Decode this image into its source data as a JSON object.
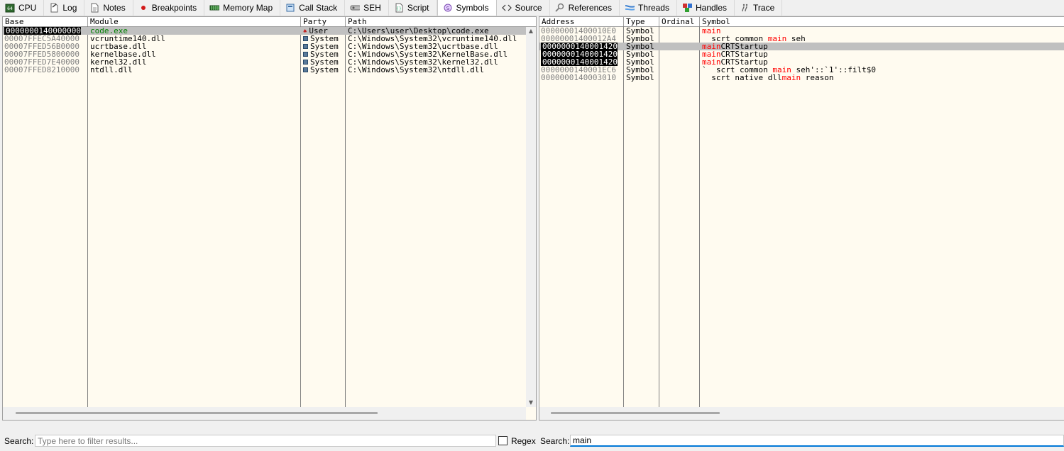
{
  "tabs": [
    {
      "label": "CPU",
      "icon": "cpu-icon"
    },
    {
      "label": "Log",
      "icon": "log-icon"
    },
    {
      "label": "Notes",
      "icon": "notes-icon"
    },
    {
      "label": "Breakpoints",
      "icon": "breakpoint-dot-icon"
    },
    {
      "label": "Memory Map",
      "icon": "memory-map-icon"
    },
    {
      "label": "Call Stack",
      "icon": "call-stack-icon"
    },
    {
      "label": "SEH",
      "icon": "seh-icon"
    },
    {
      "label": "Script",
      "icon": "script-icon"
    },
    {
      "label": "Symbols",
      "icon": "symbols-icon"
    },
    {
      "label": "Source",
      "icon": "source-icon"
    },
    {
      "label": "References",
      "icon": "references-icon"
    },
    {
      "label": "Threads",
      "icon": "threads-icon"
    },
    {
      "label": "Handles",
      "icon": "handles-icon"
    },
    {
      "label": "Trace",
      "icon": "trace-icon"
    }
  ],
  "active_tab": "Symbols",
  "modules": {
    "headers": {
      "base": "Base",
      "module": "Module",
      "party": "Party",
      "path": "Path"
    },
    "rows": [
      {
        "base": "0000000140000000",
        "module": "code.exe",
        "party": "User",
        "path": "C:\\Users\\user\\Desktop\\code.exe"
      },
      {
        "base": "00007FFEC5A40000",
        "module": "vcruntime140.dll",
        "party": "System",
        "path": "C:\\Windows\\System32\\vcruntime140.dll"
      },
      {
        "base": "00007FFED56B0000",
        "module": "ucrtbase.dll",
        "party": "System",
        "path": "C:\\Windows\\System32\\ucrtbase.dll"
      },
      {
        "base": "00007FFED5800000",
        "module": "kernelbase.dll",
        "party": "System",
        "path": "C:\\Windows\\System32\\KernelBase.dll"
      },
      {
        "base": "00007FFED7E40000",
        "module": "kernel32.dll",
        "party": "System",
        "path": "C:\\Windows\\System32\\kernel32.dll"
      },
      {
        "base": "00007FFED8210000",
        "module": "ntdll.dll",
        "party": "System",
        "path": "C:\\Windows\\System32\\ntdll.dll"
      }
    ]
  },
  "symbols": {
    "headers": {
      "address": "Address",
      "type": "Type",
      "ordinal": "Ordinal",
      "symbol": "Symbol"
    },
    "rows": [
      {
        "address": "00000001400010E0",
        "type": "Symbol",
        "ordinal": "",
        "pre": "",
        "match": "main",
        "post": ""
      },
      {
        "address": "00000001400012A4",
        "type": "Symbol",
        "ordinal": "",
        "pre": "__scrt_common_",
        "match": "main",
        "post": "_seh"
      },
      {
        "address": "0000000140001420",
        "type": "Symbol",
        "ordinal": "",
        "pre": "",
        "match": "main",
        "post": "CRTStartup"
      },
      {
        "address": "0000000140001420",
        "type": "Symbol",
        "ordinal": "",
        "pre": "",
        "match": "main",
        "post": "CRTStartup"
      },
      {
        "address": "0000000140001420",
        "type": "Symbol",
        "ordinal": "",
        "pre": "",
        "match": "main",
        "post": "CRTStartup"
      },
      {
        "address": "0000000140001EC6",
        "type": "Symbol",
        "ordinal": "",
        "pre": "`__scrt_common_",
        "match": "main",
        "post": "_seh'::`1'::filt$0"
      },
      {
        "address": "0000000140003010",
        "type": "Symbol",
        "ordinal": "",
        "pre": "__scrt_native_dll",
        "match": "main",
        "post": "_reason"
      }
    ]
  },
  "search_left": {
    "label": "Search:",
    "value": "",
    "placeholder": "Type here to filter results..."
  },
  "regex": {
    "label": "Regex",
    "checked": false
  },
  "search_right": {
    "label": "Search:",
    "value": "main",
    "placeholder": ""
  }
}
